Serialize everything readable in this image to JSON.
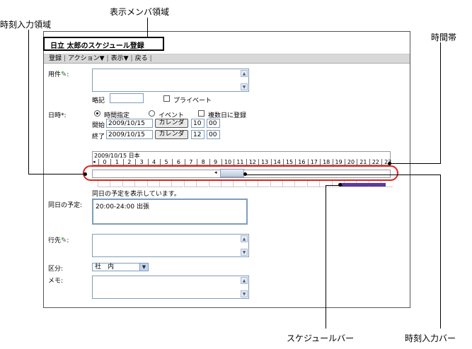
{
  "callouts": {
    "display_member_area": "表示メンバ領域",
    "time_input_area": "時刻入力領域",
    "time_band": "時間帯",
    "schedule_bar": "スケジュールバー",
    "time_input_bar": "時刻入力バー"
  },
  "window": {
    "title": "日立 太郎のスケジュール登録"
  },
  "toolbar": {
    "register": "登録",
    "action": "アクション▼",
    "view": "表示▼",
    "back": "戻る",
    "sep": "|"
  },
  "form": {
    "purpose_label": "用件",
    "abbrev_label": "略記",
    "private_label": "プライベート",
    "datetime_label": "日時*:",
    "time_specified_label": "時間指定",
    "event_label": "イベント",
    "multi_day_label": "複数日に登録",
    "start_label": "開始",
    "end_label": "終了",
    "start_date": "2009/10/15",
    "end_date": "2009/10/15",
    "calendar_button": "カレンダ",
    "start_hour": "10",
    "start_minute": "00",
    "end_hour": "12",
    "end_minute": "00",
    "timeline_header": "2009/10/15 日本",
    "hours": [
      "0",
      "1",
      "2",
      "3",
      "4",
      "5",
      "6",
      "7",
      "8",
      "9",
      "10",
      "11",
      "12",
      "13",
      "14",
      "15",
      "16",
      "17",
      "18",
      "19",
      "20",
      "21",
      "22",
      "23"
    ],
    "same_day_status": "同日の予定を表示しています。",
    "same_day_label": "同日の予定:",
    "same_day_entry": "20:00-24:00 出張",
    "destination_label": "行先",
    "category_label": "区分:",
    "category_value": "社　内",
    "memo_label": "メモ:"
  },
  "colors": {
    "highlight_oval": "#e02020",
    "schedule_bar": "#5a3a9a",
    "pen_icon": "#2a7a2a"
  }
}
